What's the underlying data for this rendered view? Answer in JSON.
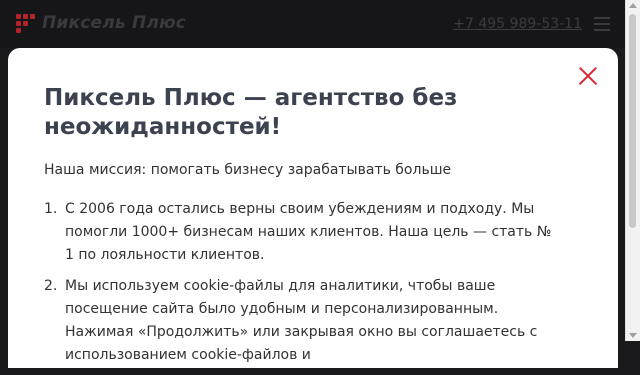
{
  "header": {
    "logo_text": "Пиксель Плюс",
    "phone": "+7 495 989-53-11"
  },
  "modal": {
    "title": "Пиксель Плюс — агентство без неожиданностей!",
    "mission": "Наша миссия: помогать бизнесу зарабатывать больше",
    "items": [
      {
        "num": "1.",
        "text": "С 2006 года остались верны своим убеждениям и подходу. Мы помогли 1000+ бизнесам наших клиентов. Наша цель — стать № 1 по лояльности клиентов."
      },
      {
        "num": "2.",
        "text": "Мы используем cookie-файлы для аналитики, чтобы ваше посещение сайта было удобным и персонализированным. Нажимая «Продолжить» или закрывая окно вы соглашаетесь с использованием cookie-файлов и"
      }
    ]
  },
  "colors": {
    "accent": "#d7262c",
    "background": "#1a1a1c",
    "title": "#3d4250"
  }
}
